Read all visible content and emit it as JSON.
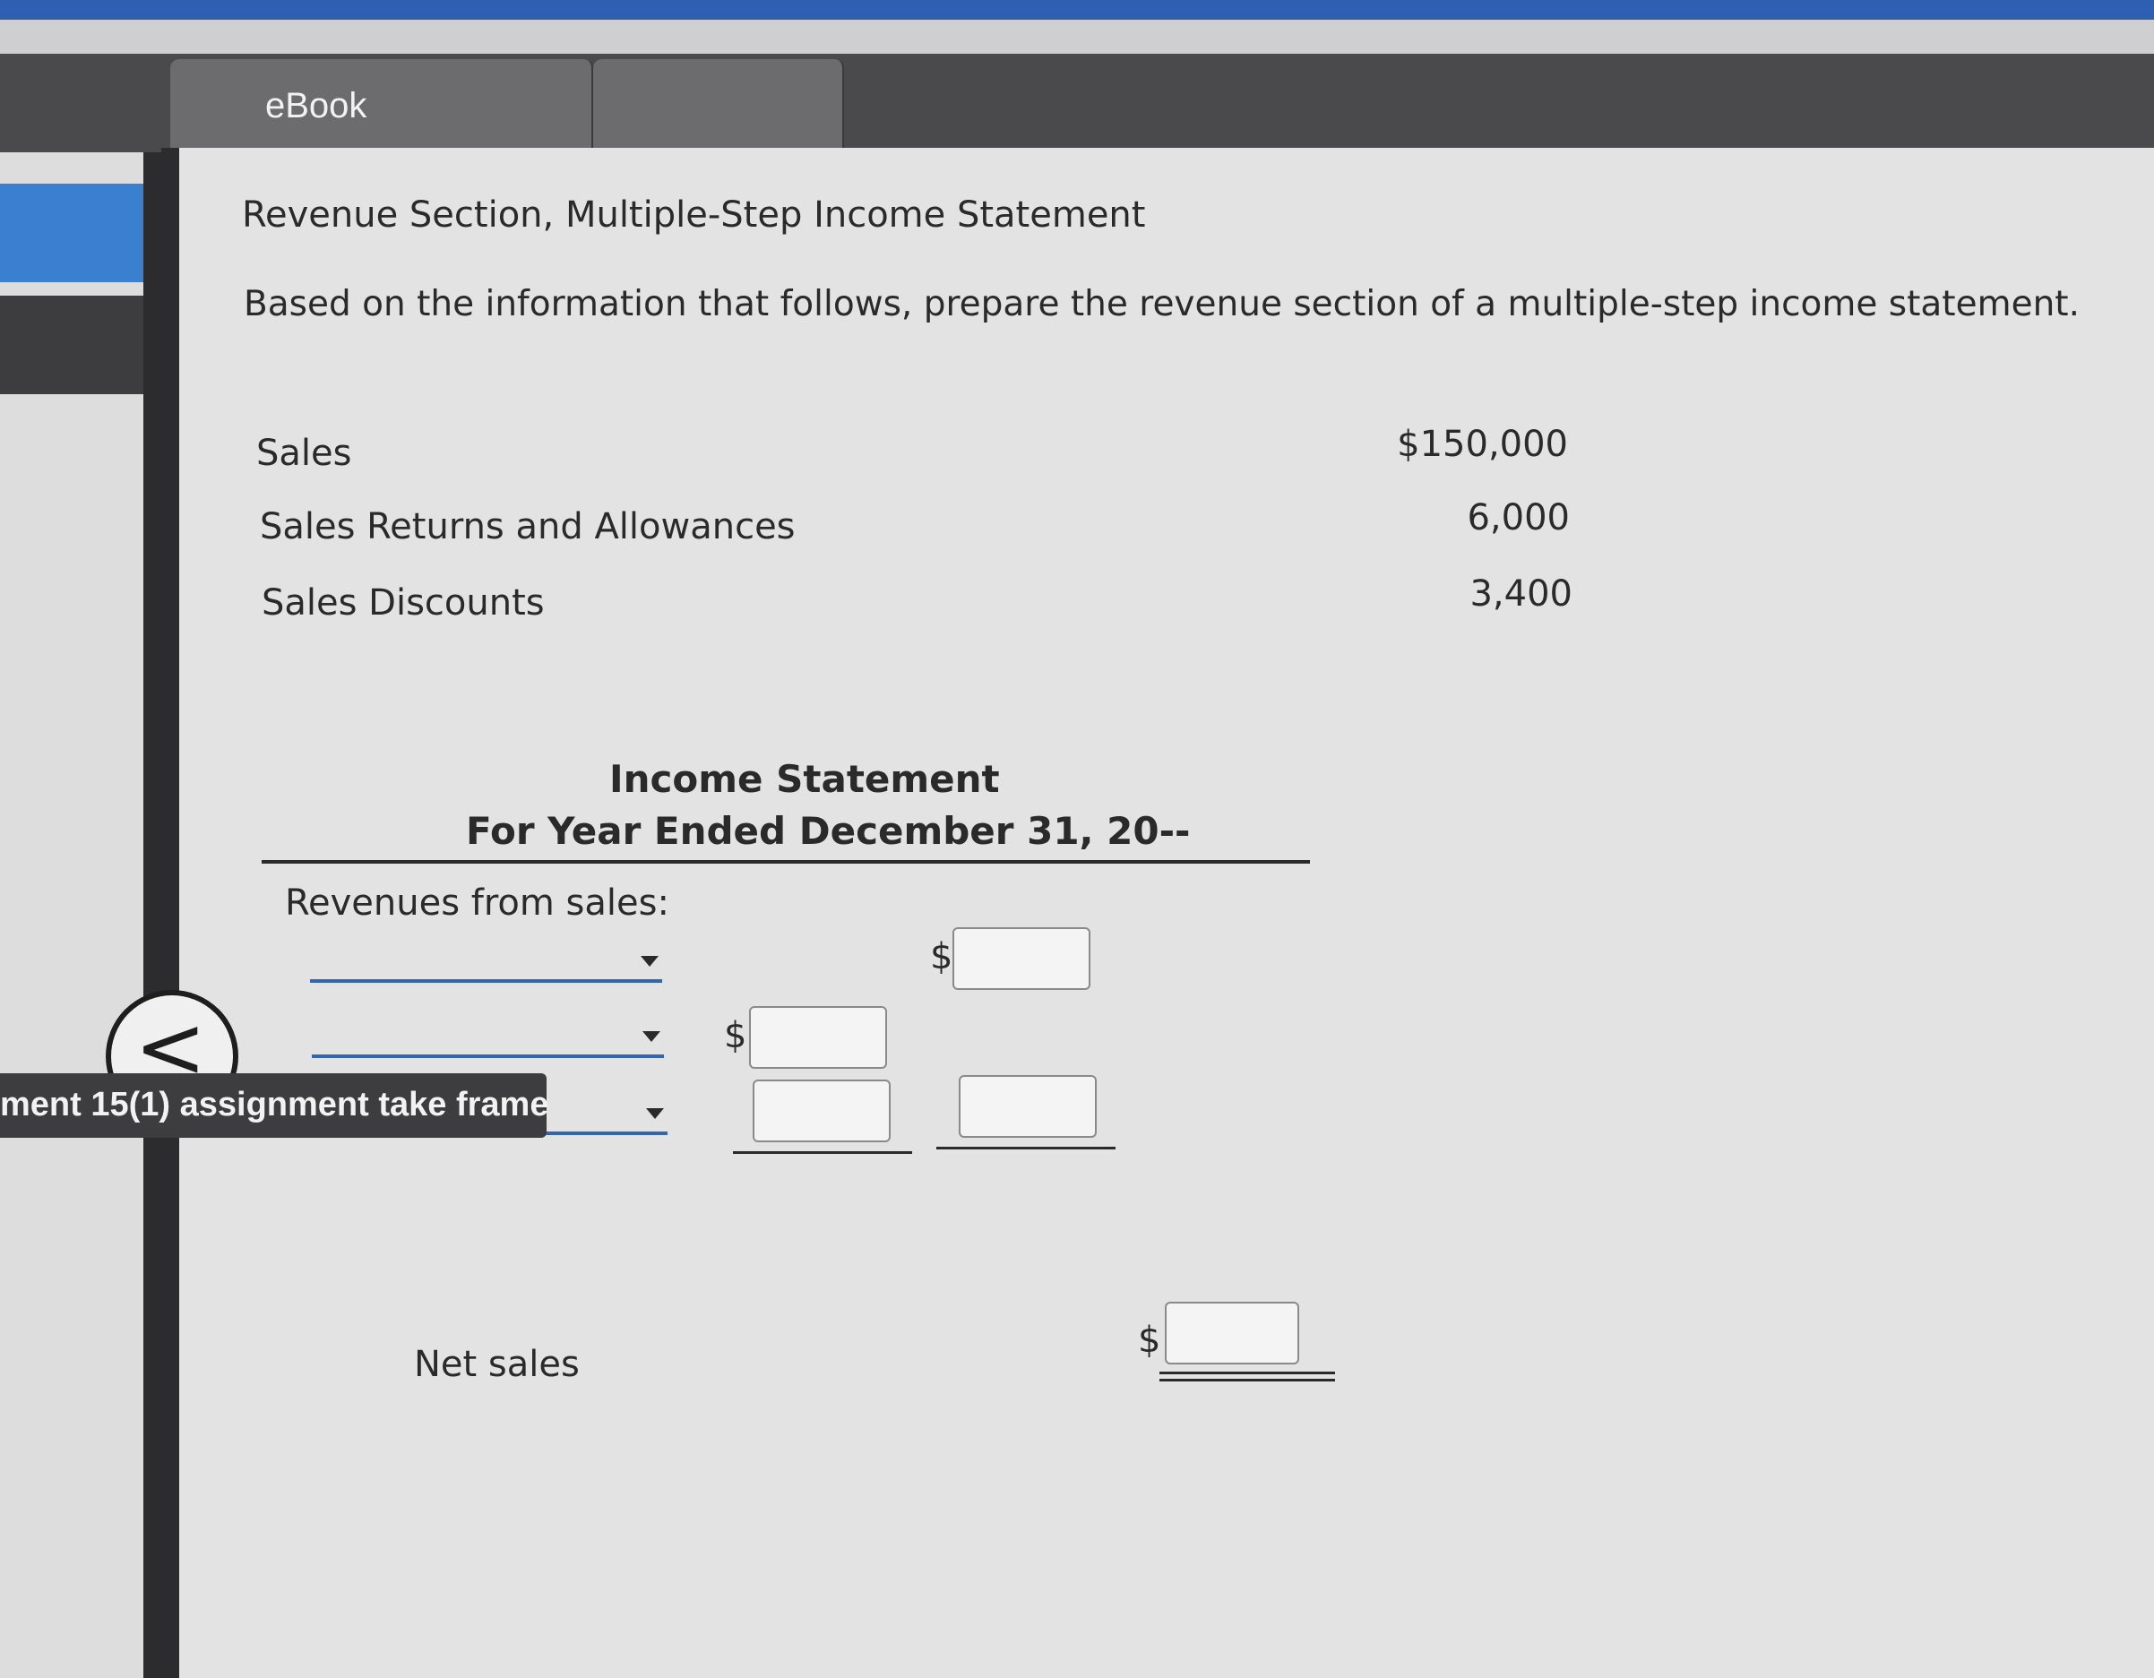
{
  "tabs": {
    "ebook_label": "eBook"
  },
  "problem": {
    "title": "Revenue Section, Multiple-Step Income Statement",
    "instructions": "Based on the information that follows, prepare the revenue section of a multiple-step income statement."
  },
  "given": [
    {
      "label": "Sales",
      "value": "$150,000"
    },
    {
      "label": "Sales Returns and Allowances",
      "value": "6,000"
    },
    {
      "label": "Sales Discounts",
      "value": "3,400"
    }
  ],
  "statement": {
    "title": "Income Statement",
    "period": "For Year Ended December 31, 20--",
    "revenues_label": "Revenues from sales:",
    "net_sales_label": "Net sales",
    "currency_symbol": "$"
  },
  "tooltip": {
    "text": "ment 15(1) assignment take frame"
  },
  "collapse_button": {
    "glyph": "<"
  }
}
